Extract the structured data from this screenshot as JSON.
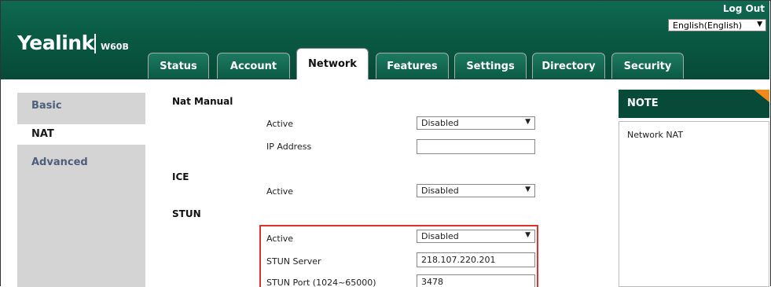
{
  "header": {
    "logo": "Yealink",
    "model": "W60B",
    "logout": "Log Out",
    "language": "English(English)"
  },
  "tabs": [
    {
      "label": "Status",
      "active": false
    },
    {
      "label": "Account",
      "active": false
    },
    {
      "label": "Network",
      "active": true
    },
    {
      "label": "Features",
      "active": false
    },
    {
      "label": "Settings",
      "active": false
    },
    {
      "label": "Directory",
      "active": false
    },
    {
      "label": "Security",
      "active": false
    }
  ],
  "sidebar": {
    "items": [
      {
        "label": "Basic",
        "active": false
      },
      {
        "label": "NAT",
        "active": true
      },
      {
        "label": "Advanced",
        "active": false
      }
    ]
  },
  "nat_manual": {
    "title": "Nat Manual",
    "active_label": "Active",
    "active_value": "Disabled",
    "ip_label": "IP Address",
    "ip_value": ""
  },
  "ice": {
    "title": "ICE",
    "active_label": "Active",
    "active_value": "Disabled"
  },
  "stun": {
    "title": "STUN",
    "active_label": "Active",
    "active_value": "Disabled",
    "server_label": "STUN Server",
    "server_value": "218.107.220.201",
    "port_label": "STUN Port (1024~65000)",
    "port_value": "3478"
  },
  "note": {
    "title": "NOTE",
    "text": "Network NAT"
  },
  "colors": {
    "header_green": "#0a5b45",
    "note_accent": "#f18a1c",
    "highlight": "#e03030",
    "sidebar_bg": "#d4d4d4"
  }
}
